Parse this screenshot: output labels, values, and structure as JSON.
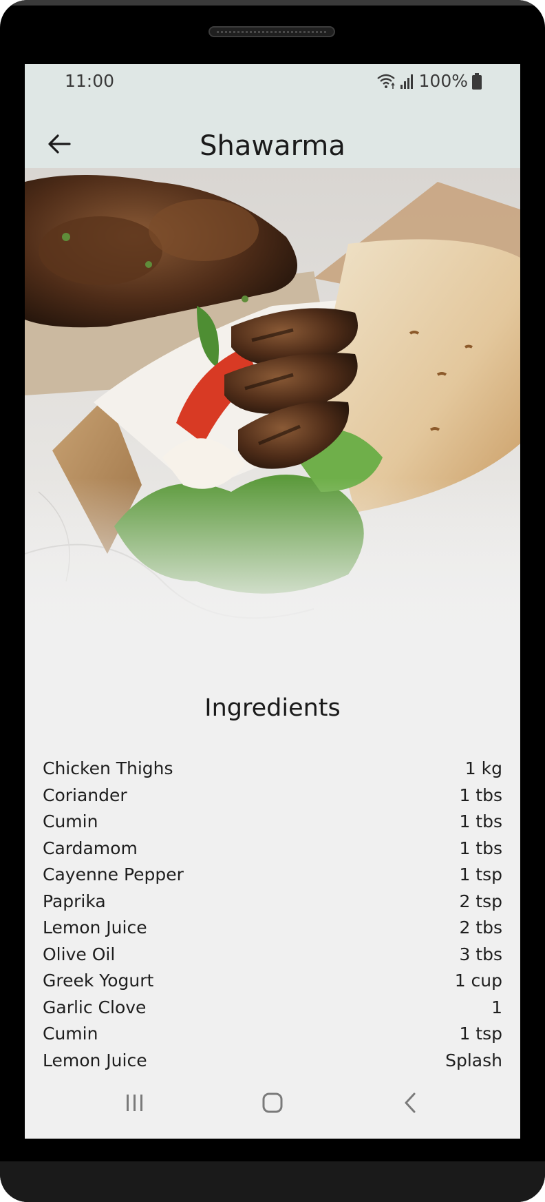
{
  "status_bar": {
    "time": "11:00",
    "battery_percent": "100%",
    "icons": [
      "wifi-icon",
      "signal-icon",
      "battery-icon"
    ]
  },
  "app_bar": {
    "title": "Shawarma",
    "back_icon": "arrow-left-icon"
  },
  "hero": {
    "image": "shawarma-wrap-photo"
  },
  "ingredients": {
    "title": "Ingredients",
    "items": [
      {
        "name": "Chicken Thighs",
        "amount": "1 kg"
      },
      {
        "name": "Coriander",
        "amount": "1 tbs"
      },
      {
        "name": "Cumin",
        "amount": "1 tbs"
      },
      {
        "name": "Cardamom",
        "amount": "1 tbs"
      },
      {
        "name": "Cayenne Pepper",
        "amount": "1 tsp"
      },
      {
        "name": "Paprika",
        "amount": "2 tsp"
      },
      {
        "name": "Lemon Juice",
        "amount": "2 tbs"
      },
      {
        "name": "Olive Oil",
        "amount": "3 tbs"
      },
      {
        "name": "Greek Yogurt",
        "amount": "1 cup"
      },
      {
        "name": "Garlic Clove",
        "amount": "1"
      },
      {
        "name": "Cumin",
        "amount": "1 tsp"
      },
      {
        "name": "Lemon Juice",
        "amount": "Splash"
      }
    ]
  },
  "nav_bar": {
    "icons": [
      "recent-apps-icon",
      "home-icon",
      "back-icon"
    ]
  },
  "colors": {
    "app_bar_bg": "#dfe7e5",
    "content_bg": "#f0f0f0",
    "text": "#1a1a1a"
  }
}
